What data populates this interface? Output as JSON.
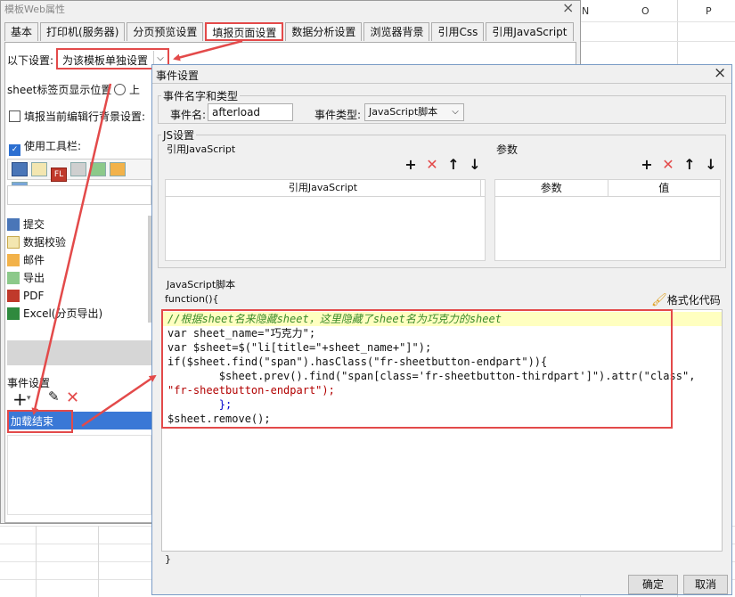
{
  "back_dialog": {
    "title": "模板Web属性",
    "close_glyph": "×",
    "tabs": [
      "基本",
      "打印机(服务器)",
      "分页预览设置",
      "填报页面设置",
      "数据分析设置",
      "浏览器背景",
      "引用Css",
      "引用JavaScript"
    ],
    "settings_label": "以下设置:",
    "settings_value": "为该模板单独设置",
    "sheet_label": "sheet标签页显示位置",
    "sheet_option_top": "上",
    "row_bg_label": "填报当前编辑行背景设置:",
    "toolbar_label": "使用工具栏:",
    "toolbar_items": [
      "提交",
      "数据校验",
      "邮件",
      "导出",
      "PDF",
      "Excel(分页导出)"
    ],
    "event_settings_label": "事件设置",
    "event_item": "加载结束"
  },
  "sheet_columns": [
    "N",
    "O",
    "P"
  ],
  "front_dialog": {
    "title": "事件设置",
    "close_glyph": "×",
    "group_name_type": "事件名字和类型",
    "event_name_label": "事件名:",
    "event_name_value": "afterload",
    "event_type_label": "事件类型:",
    "event_type_value": "JavaScript脚本",
    "js_settings_label": "JS设置",
    "ref_js_label": "引用JavaScript",
    "ref_js_column": "引用JavaScript",
    "params_label": "参数",
    "param_columns": [
      "参数",
      "值"
    ],
    "script_label": "JavaScript脚本",
    "function_open": "function(){",
    "format_code": "格式化代码",
    "function_close": "}",
    "ok_button": "确定",
    "cancel_button": "取消",
    "code_lines": [
      "//根据sheet名来隐藏sheet，这里隐藏了sheet名为巧克力的sheet",
      "var sheet_name=\"巧克力\";",
      "var $sheet=$(\"li[title=\"+sheet_name+\"]\");",
      "if($sheet.find(\"span\").hasClass(\"fr-sheetbutton-endpart\")){",
      "        $sheet.prev().find(\"span[class='fr-sheetbutton-thirdpart']\").attr(\"class\",",
      "\"fr-sheetbutton-endpart\");",
      "        };",
      "$sheet.remove();"
    ]
  },
  "colors": {
    "highlight_red": "#e34a4a",
    "selection_blue": "#3a78d6",
    "code_highlight": "#ffffc0"
  }
}
